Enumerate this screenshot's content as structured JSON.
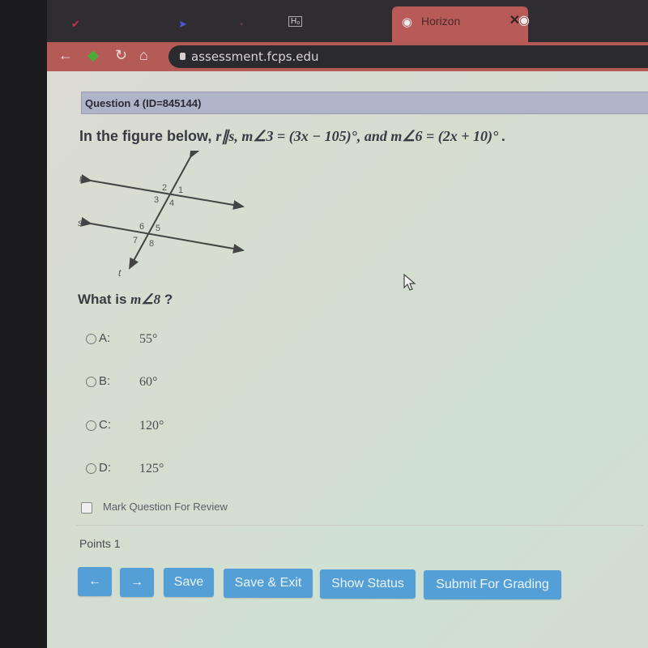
{
  "browser": {
    "tabs": [
      {
        "icon": "check-icon",
        "active": false
      },
      {
        "icon": "play-icon",
        "active": false
      },
      {
        "icon": "dot-icon",
        "active": false
      },
      {
        "icon": "app-icon",
        "label": "H₀",
        "active": false
      },
      {
        "icon": "globe-icon",
        "label": "Horizon",
        "active": true
      }
    ],
    "close_glyph": "✕",
    "url": "assessment.fcps.edu"
  },
  "question": {
    "header": "Question 4 (ID=845144)",
    "prompt_lead": "In the figure below, ",
    "prompt_math": "r∥s, m∠3 = (3x − 105)°, and m∠6 = (2x + 10)° .",
    "figure": {
      "line_labels": [
        "r",
        "s",
        "t"
      ],
      "angle_labels": [
        "1",
        "2",
        "3",
        "4",
        "5",
        "6",
        "7",
        "8"
      ]
    },
    "ask_lead": "What is ",
    "ask_math": "m∠8",
    "ask_tail": " ?",
    "options": [
      {
        "letter": "A:",
        "value": "55°"
      },
      {
        "letter": "B:",
        "value": "60°"
      },
      {
        "letter": "C:",
        "value": "120°"
      },
      {
        "letter": "D:",
        "value": "125°"
      }
    ],
    "review_label": "Mark Question For Review",
    "points": "Points 1"
  },
  "buttons": {
    "prev": "←",
    "next": "→",
    "save": "Save",
    "save_exit": "Save & Exit",
    "show_status": "Show Status",
    "submit": "Submit For Grading"
  },
  "colors": {
    "button": "#54a0d6",
    "tab_active": "#b85a58",
    "header_bar": "#b0b4c8"
  }
}
